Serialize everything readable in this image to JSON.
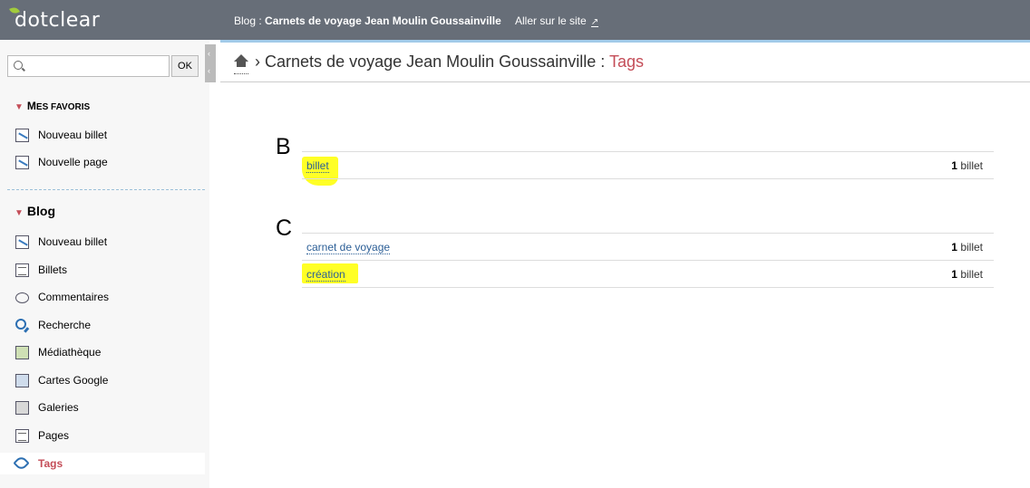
{
  "header": {
    "logo": "dotclear",
    "blog_prefix": "Blog :",
    "blog_name": "Carnets de voyage Jean Moulin Goussainville",
    "goto_site": "Aller sur le site",
    "accent": "#a2cb3c"
  },
  "sidebar": {
    "search_placeholder": "",
    "ok_label": "OK",
    "favorites_title_first": "M",
    "favorites_title_rest": "ES FAVORIS",
    "favorites": [
      {
        "label": "Nouveau billet",
        "icon": "new-post-icon"
      },
      {
        "label": "Nouvelle page",
        "icon": "new-page-icon"
      }
    ],
    "blog_title": "Blog",
    "items": [
      {
        "label": "Nouveau billet",
        "icon": "new-post-icon"
      },
      {
        "label": "Billets",
        "icon": "posts-icon"
      },
      {
        "label": "Commentaires",
        "icon": "comments-icon"
      },
      {
        "label": "Recherche",
        "icon": "search-icon"
      },
      {
        "label": "Médiathèque",
        "icon": "media-icon"
      },
      {
        "label": "Cartes Google",
        "icon": "map-icon"
      },
      {
        "label": "Galeries",
        "icon": "gallery-icon"
      },
      {
        "label": "Pages",
        "icon": "pages-icon"
      },
      {
        "label": "Tags",
        "icon": "tag-icon",
        "active": true
      }
    ]
  },
  "breadcrumb": {
    "separator": "›",
    "blog": "Carnets de voyage Jean Moulin Goussainville",
    "colon": ":",
    "current": "Tags"
  },
  "tag_groups": [
    {
      "letter": "B",
      "tags": [
        {
          "name": "billet",
          "count": "1",
          "unit": "billet",
          "highlighted": true
        }
      ]
    },
    {
      "letter": "C",
      "tags": [
        {
          "name": "carnet de voyage",
          "count": "1",
          "unit": "billet",
          "highlighted": false
        },
        {
          "name": "création",
          "count": "1",
          "unit": "billet",
          "highlighted": true
        }
      ]
    }
  ],
  "colors": {
    "active": "#c44d58",
    "link": "#2b5e96",
    "highlight": "#ffff00"
  }
}
